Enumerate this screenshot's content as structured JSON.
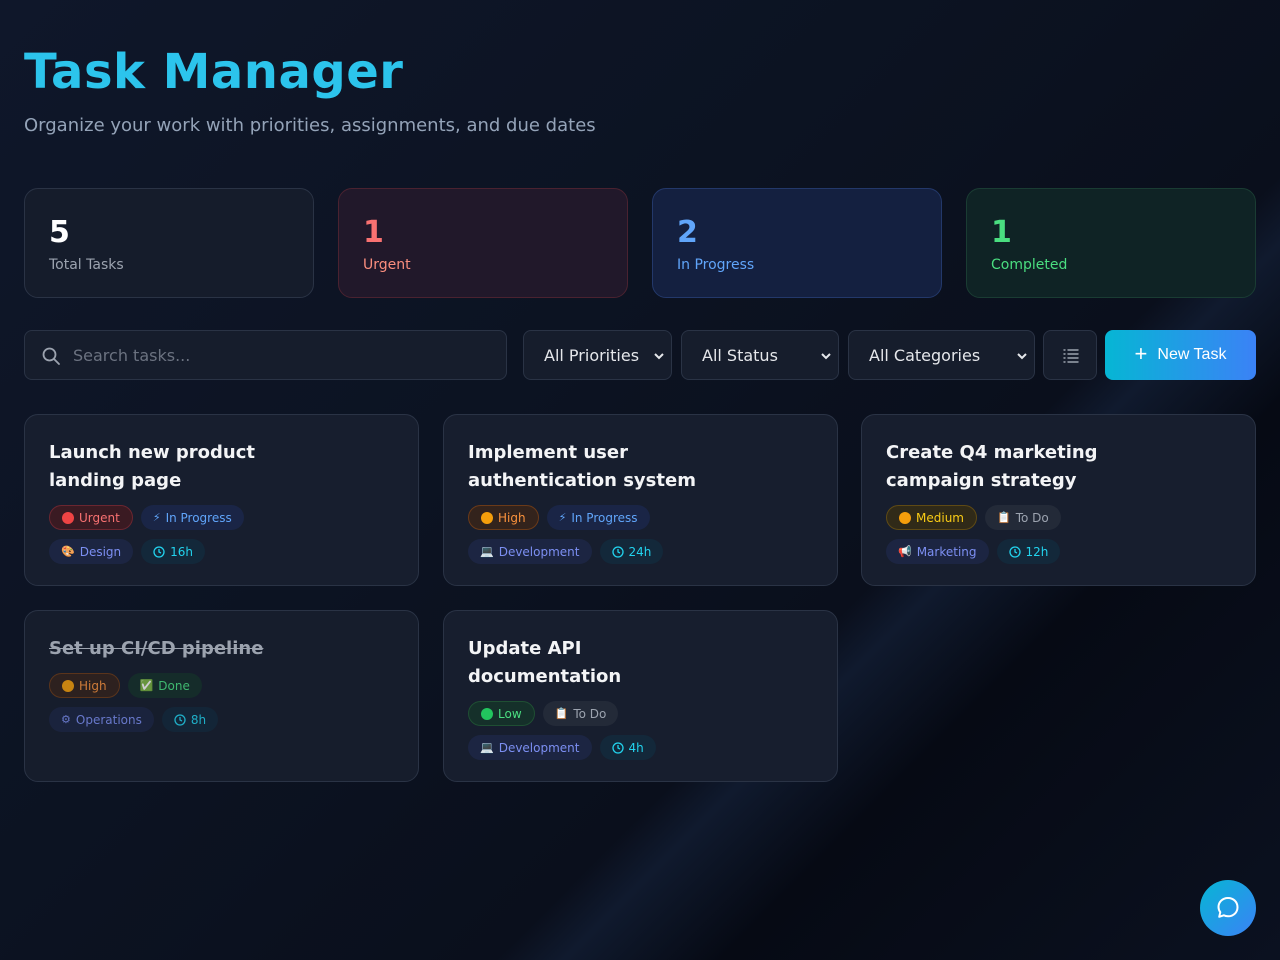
{
  "header": {
    "title": "Task Manager",
    "subtitle": "Organize your work with priorities, assignments, and due dates"
  },
  "stats": {
    "total": {
      "value": "5",
      "label": "Total Tasks"
    },
    "urgent": {
      "value": "1",
      "label": "Urgent"
    },
    "in_progress": {
      "value": "2",
      "label": "In Progress"
    },
    "completed": {
      "value": "1",
      "label": "Completed"
    }
  },
  "toolbar": {
    "search_placeholder": "Search tasks...",
    "priority_filter": "All Priorities",
    "status_filter": "All Status",
    "category_filter": "All Categories",
    "new_task_label": "New Task"
  },
  "tasks": [
    {
      "title": "Launch new product landing page",
      "priority": "Urgent",
      "status": "In Progress",
      "status_icon": "⚡",
      "category": "Design",
      "category_icon": "🎨",
      "hours": "16h"
    },
    {
      "title": "Implement user authentication system",
      "priority": "High",
      "status": "In Progress",
      "status_icon": "⚡",
      "category": "Development",
      "category_icon": "💻",
      "hours": "24h"
    },
    {
      "title": "Create Q4 marketing campaign strategy",
      "priority": "Medium",
      "status": "To Do",
      "status_icon": "📋",
      "category": "Marketing",
      "category_icon": "📢",
      "hours": "12h"
    },
    {
      "title": "Set up CI/CD pipeline",
      "priority": "High",
      "status": "Done",
      "status_icon": "✅",
      "category": "Operations",
      "category_icon": "⚙",
      "hours": "8h"
    },
    {
      "title": "Update API documentation",
      "priority": "Low",
      "status": "To Do",
      "status_icon": "📋",
      "category": "Development",
      "category_icon": "💻",
      "hours": "4h"
    }
  ],
  "colors": {
    "accent": "#2cc4ec",
    "urgent": "#ef4444",
    "high": "#f59e0b",
    "low": "#22c55e",
    "in_progress": "#60a5fa"
  }
}
